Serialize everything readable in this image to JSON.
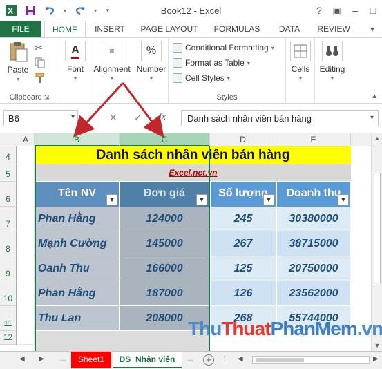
{
  "window": {
    "title": "Book12 - Excel"
  },
  "qat": {
    "save_icon": "save-icon",
    "undo_icon": "undo-icon",
    "redo_icon": "redo-icon"
  },
  "tabs": [
    "FILE",
    "HOME",
    "INSERT",
    "PAGE LAYOUT",
    "FORMULAS",
    "DATA",
    "REVIEW"
  ],
  "ribbon": {
    "paste": "Paste",
    "clipboard": "Clipboard",
    "font": "Font",
    "alignment": "Alignment",
    "number": "Number",
    "number_symbol": "%",
    "conditional": "Conditional Formatting",
    "format_table": "Format as Table",
    "cell_styles": "Cell Styles",
    "styles": "Styles",
    "cells": "Cells",
    "editing": "Editing"
  },
  "formula_bar": {
    "name_box": "B6",
    "formula": "Danh sách nhân viên bán hàng",
    "fx": "fx"
  },
  "columns": [
    "A",
    "B",
    "C",
    "D",
    "E"
  ],
  "rows": [
    "4",
    "5",
    "6",
    "7",
    "8",
    "9",
    "10",
    "11",
    "12"
  ],
  "sheet": {
    "title": "Danh sách nhân viên bán hàng",
    "subtitle": "Excel.net.vn",
    "headers": [
      "Tên NV",
      "Đơn giá",
      "Số lượng",
      "Doanh thu"
    ],
    "data": [
      [
        "Phan Hằng",
        "124000",
        "245",
        "30380000"
      ],
      [
        "Mạnh Cường",
        "145000",
        "267",
        "38715000"
      ],
      [
        "Oanh Thu",
        "166000",
        "125",
        "20750000"
      ],
      [
        "Phan Hằng",
        "187000",
        "126",
        "23562000"
      ],
      [
        "Thu Lan",
        "208000",
        "268",
        "55744000"
      ]
    ]
  },
  "sheet_tabs": {
    "tab1": "Sheet1",
    "tab2": "DS_Nhân viên"
  },
  "watermark": {
    "p1": "Thu",
    "p2": "Thuat",
    "p3": "PhanMem",
    "p4": ".vn"
  },
  "colors": {
    "excel_green": "#217346",
    "header_blue": "#5b9bd5",
    "title_yellow": "#ffff00",
    "arrow_red": "#c0282d"
  }
}
